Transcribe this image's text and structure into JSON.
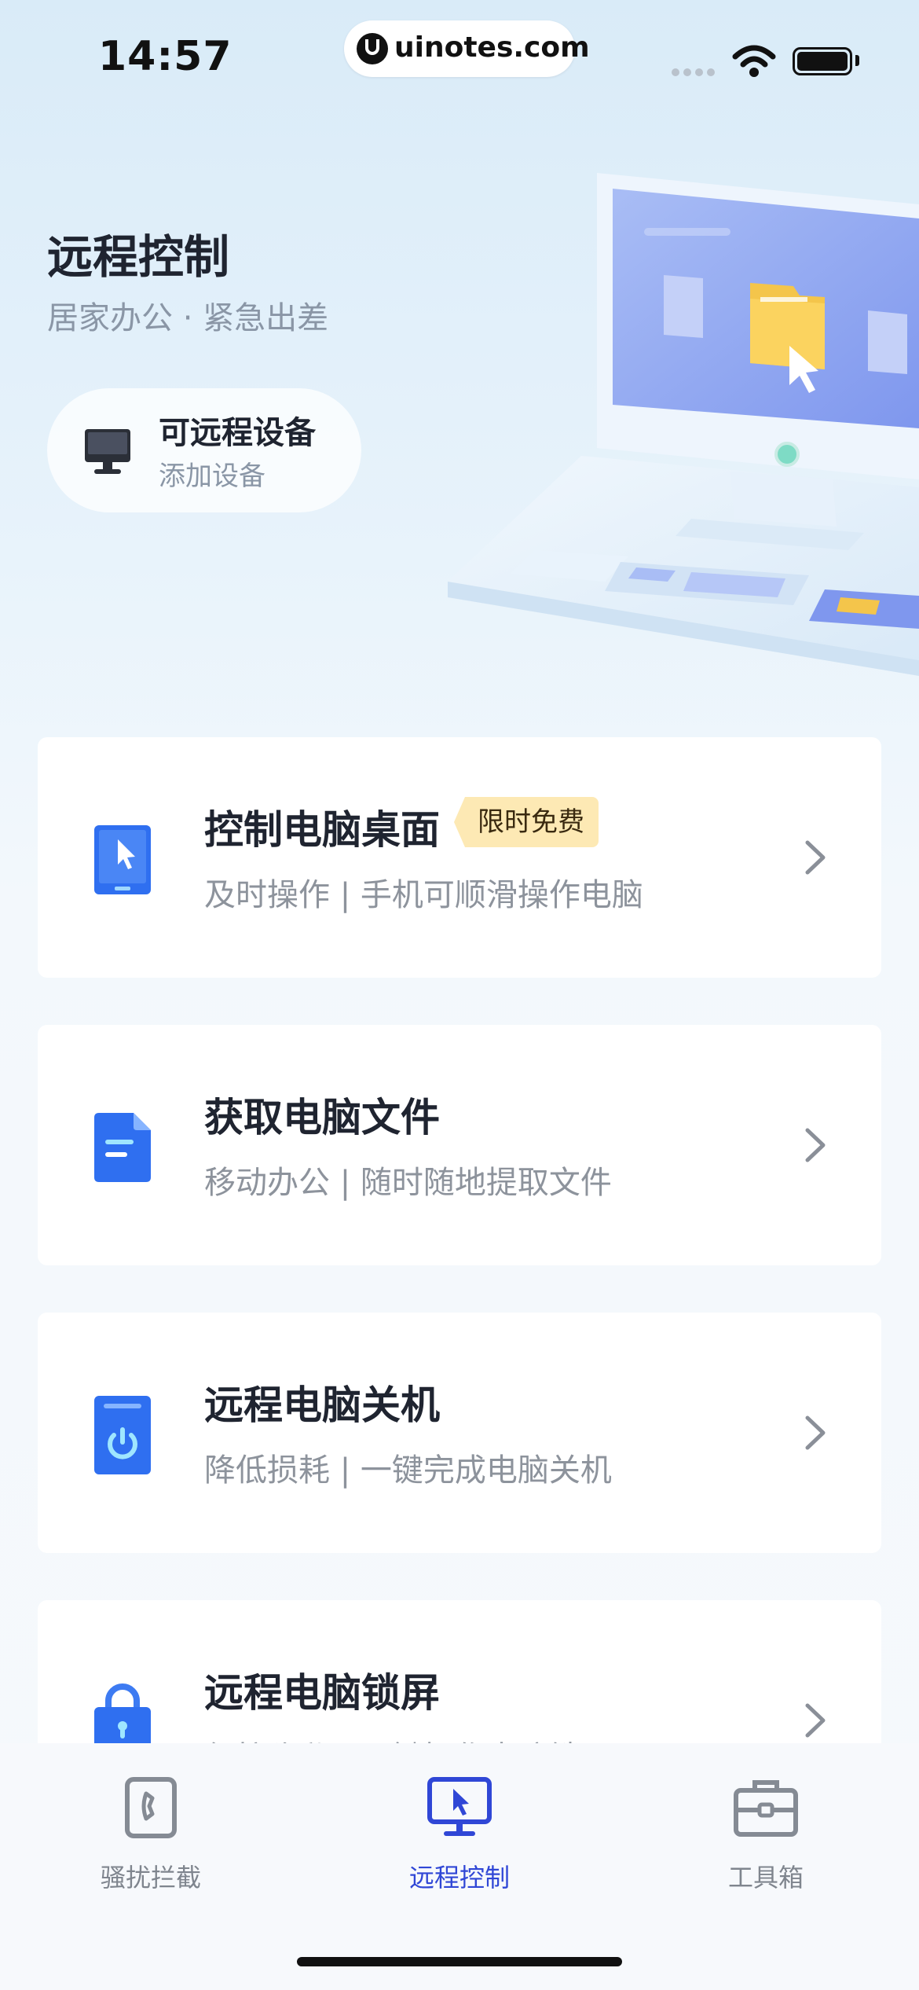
{
  "status_bar": {
    "time": "14:57",
    "site": "uinotes.com"
  },
  "hero": {
    "title": "远程控制",
    "subtitle": "居家办公 · 紧急出差",
    "device_pill": {
      "title": "可远程设备",
      "subtitle": "添加设备"
    }
  },
  "features": [
    {
      "title": "控制电脑桌面",
      "badge": "限时免费",
      "subtitle": "及时操作 | 手机可顺滑操作电脑",
      "icon": "tablet-cursor-icon"
    },
    {
      "title": "获取电脑文件",
      "subtitle": "移动办公 | 随时随地提取文件",
      "icon": "document-icon"
    },
    {
      "title": "远程电脑关机",
      "subtitle": "降低损耗 | 一键完成电脑关机",
      "icon": "power-icon"
    },
    {
      "title": "远程电脑锁屏",
      "subtitle": "保护隐私 | 一键操作电脑锁屏",
      "icon": "lock-icon"
    }
  ],
  "tabbar": {
    "tabs": [
      {
        "label": "骚扰拦截",
        "icon": "phone-block-icon",
        "active": false
      },
      {
        "label": "远程控制",
        "icon": "monitor-cursor-icon",
        "active": true
      },
      {
        "label": "工具箱",
        "icon": "toolbox-icon",
        "active": false
      }
    ]
  },
  "colors": {
    "accent": "#3047d6",
    "icon_blue": "#2f6ff0",
    "badge_bg": "#fde9b4"
  }
}
